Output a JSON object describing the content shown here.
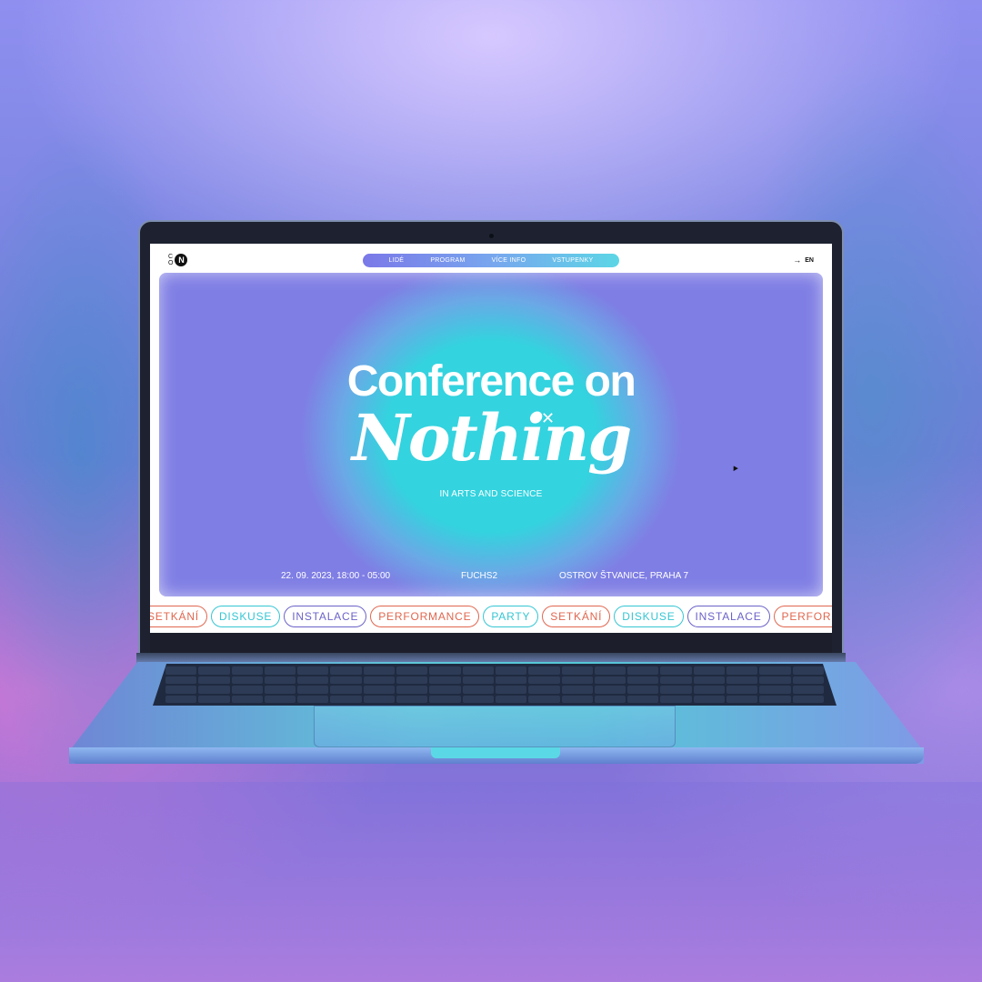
{
  "site": {
    "logo": {
      "small_top": "C",
      "small_bottom": "O",
      "mark": "N"
    },
    "nav": [
      {
        "label": "LIDÉ"
      },
      {
        "label": "PROGRAM"
      },
      {
        "label": "VÍCE INFO"
      },
      {
        "label": "VSTUPENKY"
      }
    ],
    "language": {
      "arrow": "→",
      "label": "EN"
    },
    "hero": {
      "title": "Conference on",
      "title_art": "Nothing",
      "subtitle": "IN ARTS AND SCIENCE",
      "date": "22. 09. 2023, 18:00 - 05:00",
      "venue": "FUCHS2",
      "address": "OSTROV ŠTVANICE, PRAHA 7"
    },
    "tags": [
      {
        "label": "SETKÁNÍ",
        "color": "#e0674f"
      },
      {
        "label": "DISKUSE",
        "color": "#35c6d3"
      },
      {
        "label": "INSTALACE",
        "color": "#6b63c8"
      },
      {
        "label": "PERFORMANCE",
        "color": "#e0674f"
      },
      {
        "label": "PARTY",
        "color": "#35c6d3"
      },
      {
        "label": "SETKÁNÍ",
        "color": "#e0674f"
      },
      {
        "label": "DISKUSE",
        "color": "#35c6d3"
      },
      {
        "label": "INSTALACE",
        "color": "#6b63c8"
      },
      {
        "label": "PERFORMA",
        "color": "#e0674f"
      }
    ]
  },
  "colors": {
    "hero_center": "#33d3df",
    "hero_edge": "#7f7ee4",
    "nav_pill": "#78a6ee"
  }
}
